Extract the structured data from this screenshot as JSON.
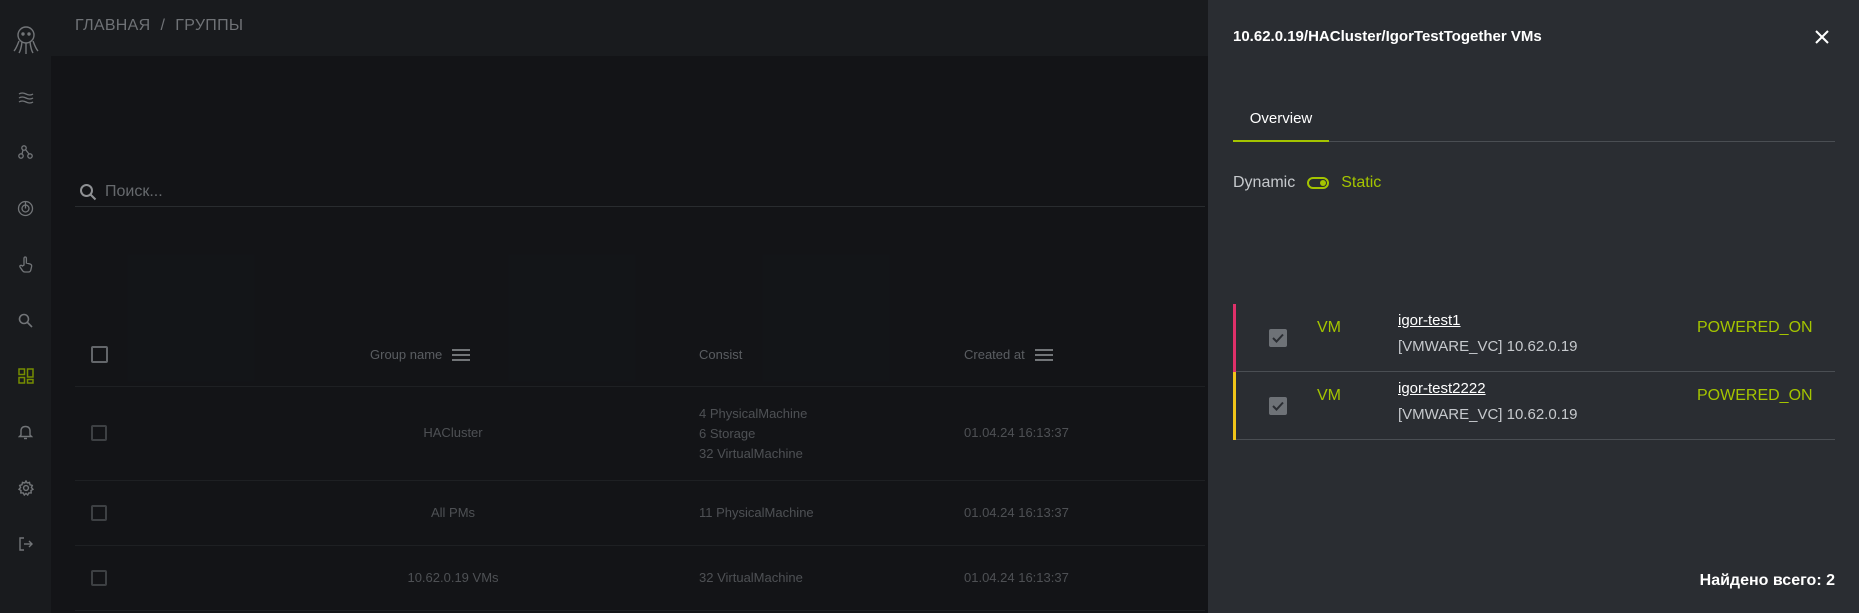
{
  "breadcrumb": {
    "home": "ГЛАВНАЯ",
    "separator": "/",
    "current": "ГРУППЫ"
  },
  "search": {
    "placeholder": "Поиск..."
  },
  "table": {
    "columns": {
      "group_name": "Group name",
      "consist": "Consist",
      "created_at": "Created at"
    },
    "rows": [
      {
        "group_name": "HACluster",
        "consist": [
          "4 PhysicalMachine",
          "6 Storage",
          "32 VirtualMachine"
        ],
        "created_at": "01.04.24 16:13:37"
      },
      {
        "group_name": "All PMs",
        "consist": [
          "11 PhysicalMachine"
        ],
        "created_at": "01.04.24 16:13:37"
      },
      {
        "group_name": "10.62.0.19 VMs",
        "consist": [
          "32 VirtualMachine"
        ],
        "created_at": "01.04.24 16:13:37"
      }
    ]
  },
  "drawer": {
    "title": "10.62.0.19/HACluster/IgorTestTogether VMs",
    "tabs": [
      {
        "label": "Overview",
        "active": true
      }
    ],
    "toggle": {
      "left_label": "Dynamic",
      "right_label": "Static",
      "state": "Static"
    },
    "items": [
      {
        "type": "VM",
        "name": "igor-test1",
        "source": "[VMWARE_VC] 10.62.0.19",
        "status": "POWERED_ON",
        "accent": "#e0306a",
        "checked": true
      },
      {
        "type": "VM",
        "name": "igor-test2222",
        "source": "[VMWARE_VC] 10.62.0.19",
        "status": "POWERED_ON",
        "accent": "#f0c419",
        "checked": true
      }
    ],
    "found_total": "Найдено всего: 2"
  },
  "sidebar": {
    "icons": [
      "octopus-logo-icon",
      "waves-icon",
      "nodes-icon",
      "radar-icon",
      "hand-pointer-icon",
      "search-icon",
      "dashboard-grid-icon",
      "bell-icon",
      "gear-icon",
      "logout-icon"
    ],
    "active": "dashboard-grid-icon"
  },
  "colors": {
    "accent": "#a4c400",
    "background": "#1b1d21",
    "sidebar": "#23262a",
    "drawer": "#2a2d32"
  }
}
